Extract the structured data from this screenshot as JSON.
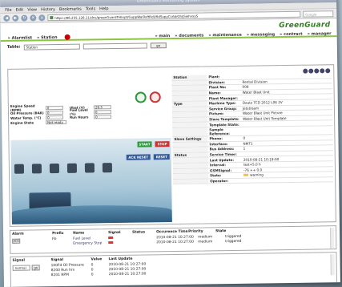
{
  "window": {
    "title": "GreenGuard Monitoring System"
  },
  "menu": [
    "File",
    "Edit",
    "View",
    "History",
    "Bookmarks",
    "Tools",
    "Help"
  ],
  "browser": {
    "url": "https://86.255.126.11/dns/greenGuardTriExpt/GuppWai9xftRdURdSupyCsrbkGS/jSwhvxyS",
    "search_placeholder": "Google"
  },
  "app": {
    "logo": "GreenGuard",
    "nav_left": [
      "Alarmlist",
      "Station"
    ],
    "nav_right": [
      "main",
      "documents",
      "maintenance",
      "messaging",
      "contract",
      "manager"
    ]
  },
  "table_row": {
    "label": "Table:",
    "selected": "Station",
    "go": "go"
  },
  "metrics": [
    {
      "k": "Engine Speed (RPM)",
      "v": "0",
      "k2": "Ubat (V)",
      "v2": "26.3"
    },
    {
      "k": "Oil Pressure (BAR)",
      "v": "0",
      "k2": "Fuel Level (%)",
      "v2": "0"
    },
    {
      "k": "Water Temp. (°C)",
      "v": "0",
      "k2": "Run Hours",
      "v2": "0"
    },
    {
      "k": "Engine State",
      "v": "Not ready",
      "k2": "",
      "v2": ""
    }
  ],
  "controls": {
    "start": "START",
    "stop": "STOP",
    "ack_reset": "ACK RESET",
    "reset": "RESET"
  },
  "info": [
    {
      "sec": "Station",
      "k": "Plant:",
      "v": ""
    },
    {
      "sec": "",
      "k": "Division:",
      "v": "Rental Division"
    },
    {
      "sec": "",
      "k": "Plant No:",
      "v": "008"
    },
    {
      "sec": "",
      "k": "Name:",
      "v": "Water Blast Unit"
    },
    {
      "sec": "",
      "k": "Plant Manager:",
      "v": ""
    },
    {
      "sec": "Type",
      "k": "Machine Type:",
      "v": "Deutz TCD 2012 L06 2V"
    },
    {
      "sec": "",
      "k": "Service Group:",
      "v": "Jetstream"
    },
    {
      "sec": "",
      "k": "Picture:",
      "v": "Water Blast Unit Picture"
    },
    {
      "sec": "",
      "k": "Slave Template:",
      "v": "Water Blast Unit Template"
    },
    {
      "sec": "",
      "k": "Template State:",
      "v": ""
    },
    {
      "sec": "",
      "k": "Sample Reference:",
      "v": ""
    },
    {
      "sec": "Slave Settings",
      "k": "Phone:",
      "v": "0"
    },
    {
      "sec": "",
      "k": "Interface:",
      "v": "NMT1"
    },
    {
      "sec": "",
      "k": "Bus Address:",
      "v": "1"
    },
    {
      "sec": "Status",
      "k": "Service Timer:",
      "v": ""
    },
    {
      "sec": "",
      "k": "Last Update:",
      "v": "2010-08-21 10:19:00"
    },
    {
      "sec": "",
      "k": "Interval:",
      "v": "last+5.0 h"
    },
    {
      "sec": "",
      "k": "GSMSignal:",
      "v": "-76 ++ 0.0"
    },
    {
      "sec": "",
      "k": "State:",
      "v": "warning"
    },
    {
      "sec": "",
      "k": "Operator:",
      "v": ""
    }
  ],
  "alarm": {
    "panel_label": "Alarm",
    "button": "ACK",
    "headers": [
      "Prefix",
      "Name",
      "Signal",
      "Status",
      "Occurence Time",
      "Priority",
      "State"
    ],
    "rows": [
      {
        "prefix": "Fb",
        "name": "Fuel Level",
        "time": "2010-08-21 10:27:00",
        "priority": "medium",
        "state": "triggered"
      },
      {
        "prefix": "",
        "name": "Emergency Stop",
        "time": "2010-08-21 10:27:00",
        "priority": "medium",
        "state": "triggered"
      }
    ]
  },
  "signal": {
    "panel_label": "Signal",
    "select": "normal",
    "go": "go",
    "headers": [
      "Signal",
      "Value",
      "Last Update"
    ],
    "rows": [
      {
        "signal": "100Fd Oil Pressure",
        "value": "0",
        "time": "2010-08-21 10:27:00"
      },
      {
        "signal": "8200 Run hrs",
        "value": "0",
        "time": "2010-08-21 10:27:00"
      },
      {
        "signal": "8201 RPM",
        "value": "0",
        "time": "2010-08-21 10:27:00"
      }
    ]
  }
}
